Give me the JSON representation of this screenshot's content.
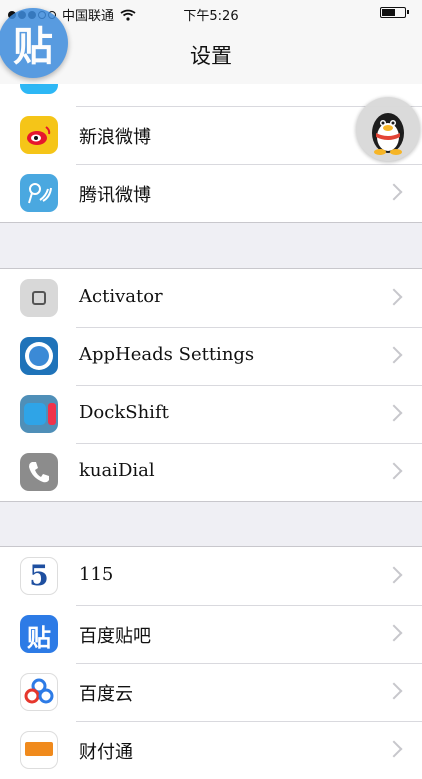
{
  "status_bar": {
    "carrier": "中国联通",
    "time": "下午5:26"
  },
  "nav": {
    "title": "设置"
  },
  "sections": [
    [
      {
        "label": "新浪微博",
        "icon": "weibo-icon"
      },
      {
        "label": "腾讯微博",
        "icon": "tencent-weibo-icon"
      }
    ],
    [
      {
        "label": "Activator",
        "icon": "activator-icon"
      },
      {
        "label": "AppHeads Settings",
        "icon": "appheads-icon"
      },
      {
        "label": "DockShift",
        "icon": "dockshift-icon"
      },
      {
        "label": "kuaiDial",
        "icon": "phone-icon"
      }
    ],
    [
      {
        "label": "115",
        "icon": "115-icon"
      },
      {
        "label": "百度贴吧",
        "icon": "baidu-tieba-icon"
      },
      {
        "label": "百度云",
        "icon": "baidu-cloud-icon"
      },
      {
        "label": "财付通",
        "icon": "tenpay-icon"
      }
    ]
  ],
  "floating": {
    "tieba_glyph": "贴",
    "qq": "qq-penguin-icon"
  },
  "colors": {
    "background": "#efeff4",
    "bar": "#f7f7f7",
    "chevron": "#c7c7cc",
    "tieba_blue": "#3d8bdc"
  }
}
